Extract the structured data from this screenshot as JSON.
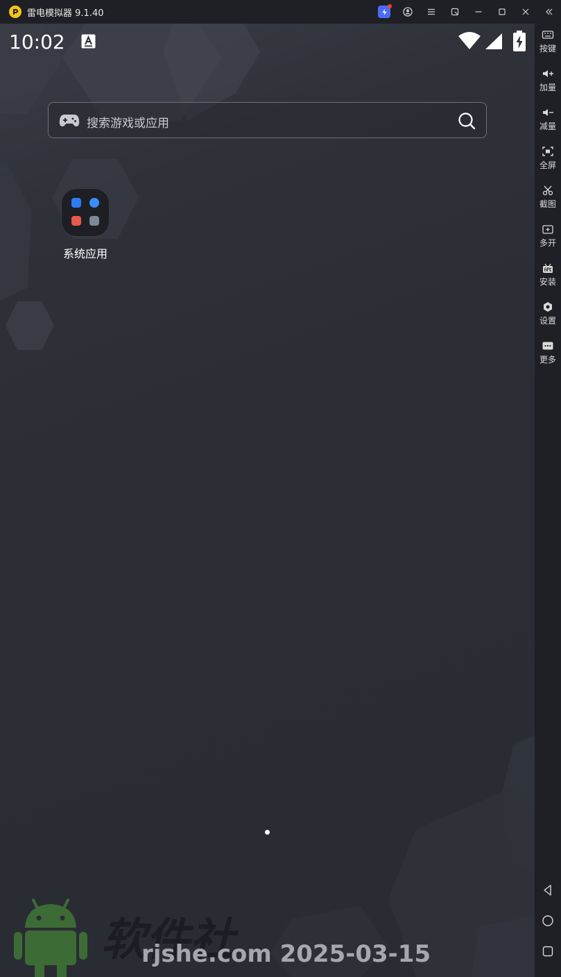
{
  "window": {
    "title": "雷电模拟器 9.1.40"
  },
  "statusbar": {
    "time": "10:02"
  },
  "search": {
    "placeholder": "搜索游戏或应用"
  },
  "home": {
    "folder_label": "系统应用"
  },
  "sidebar": {
    "items": [
      {
        "label": "按键",
        "icon": "keyboard-icon"
      },
      {
        "label": "加量",
        "icon": "volume-up-icon"
      },
      {
        "label": "减量",
        "icon": "volume-down-icon"
      },
      {
        "label": "全屏",
        "icon": "fullscreen-icon"
      },
      {
        "label": "截图",
        "icon": "scissors-icon"
      },
      {
        "label": "多开",
        "icon": "multi-instance-icon"
      },
      {
        "label": "安装",
        "icon": "apk-icon"
      },
      {
        "label": "设置",
        "icon": "gear-icon"
      },
      {
        "label": "更多",
        "icon": "more-icon"
      }
    ],
    "nav": [
      "back-icon",
      "home-icon",
      "recents-icon"
    ]
  },
  "watermark": {
    "site_name": "软件社",
    "domain_date": "rjshe.com 2025-03-15"
  },
  "colors": {
    "titlebar_bg": "#1f2025",
    "screen_bg": "#2b2d35",
    "accent_logo": "#f5c518",
    "boost_blue": "#4a6cf7"
  }
}
